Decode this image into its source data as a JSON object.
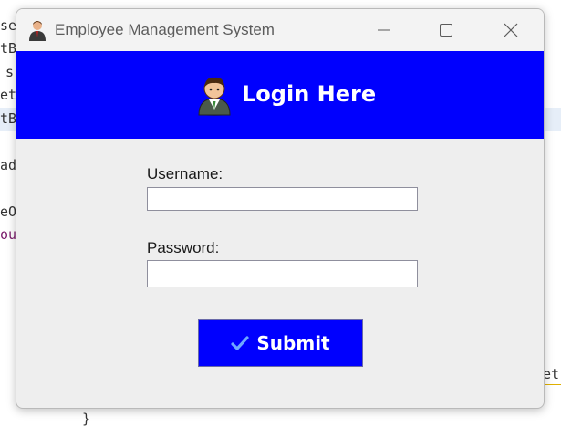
{
  "window": {
    "title": "Employee Management System"
  },
  "header": {
    "heading": "Login Here"
  },
  "form": {
    "username_label": "Username:",
    "username_value": "",
    "password_label": "Password:",
    "password_value": "",
    "submit_label": "Submit"
  },
  "background_code": {
    "lines": [
      "se",
      "tB",
      "s",
      "et",
      "tB",
      "ad",
      "eO",
      "oui",
      "et",
      "}"
    ]
  },
  "colors": {
    "header_bg": "#0000fe",
    "button_bg": "#0000fe",
    "window_bg": "#eeeeee",
    "check_icon": "#6ea8ff"
  }
}
